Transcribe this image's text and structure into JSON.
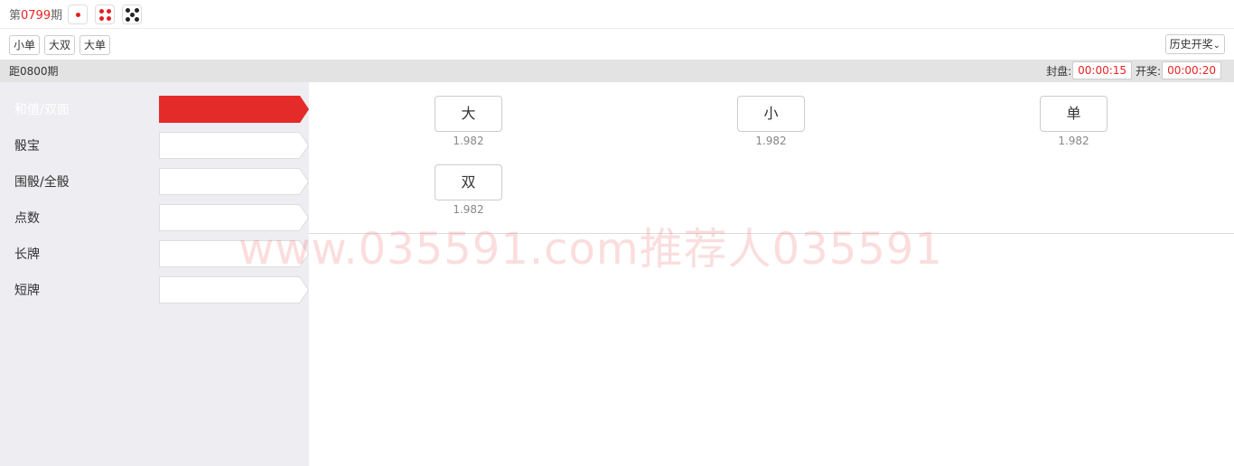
{
  "header": {
    "period_prefix": "第",
    "period_number": "0799",
    "period_suffix": "期",
    "dice": [
      1,
      4,
      5
    ]
  },
  "filters": [
    "小单",
    "大双",
    "大单"
  ],
  "history_button": "历史开奖",
  "info": {
    "next_period": "距0800期",
    "close_label": "封盘:",
    "close_time": "00:00:15",
    "draw_label": "开奖:",
    "draw_time": "00:00:20"
  },
  "sidebar": {
    "items": [
      {
        "label": "和值/双面",
        "active": true
      },
      {
        "label": "骰宝",
        "active": false
      },
      {
        "label": "围骰/全骰",
        "active": false
      },
      {
        "label": "点数",
        "active": false
      },
      {
        "label": "长牌",
        "active": false
      },
      {
        "label": "短牌",
        "active": false
      }
    ]
  },
  "bets": [
    {
      "label": "大",
      "odds": "1.982"
    },
    {
      "label": "小",
      "odds": "1.982"
    },
    {
      "label": "单",
      "odds": "1.982"
    },
    {
      "label": "双",
      "odds": "1.982"
    }
  ],
  "watermark": "www.035591.com推荐人035591",
  "colors": {
    "accent": "#e52a2a",
    "sidebar_bg": "#ededf2"
  }
}
